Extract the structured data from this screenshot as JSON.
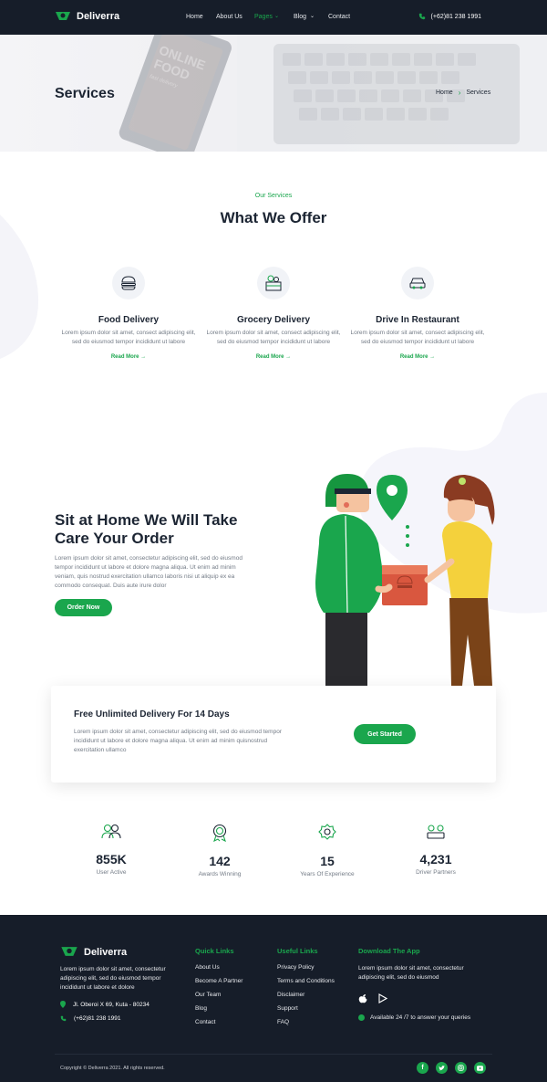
{
  "nav": {
    "brand": "Deliverra",
    "items": [
      {
        "label": "Home"
      },
      {
        "label": "About Us"
      },
      {
        "label": "Pages"
      },
      {
        "label": "Blog"
      },
      {
        "label": "Contact"
      }
    ],
    "phone": "(+62)81 238 1991"
  },
  "hero": {
    "title": "Services",
    "breadcrumb": [
      "Home",
      "Services"
    ],
    "bg_text": [
      "ONLINE",
      "FOOD",
      "fast delivery"
    ]
  },
  "offer": {
    "subtitle": "Our Services",
    "title": "What We Offer",
    "cards": [
      {
        "title": "Food Delivery",
        "text": "Lorem ipsum dolor sit amet, consect adipiscing elit, sed do eiusmod tempor incididunt ut labore",
        "link": "Read More",
        "icon": "burger-icon"
      },
      {
        "title": "Grocery Delivery",
        "text": "Lorem ipsum dolor sit amet, consect adipiscing elit, sed do eiusmod tempor incididunt ut labore",
        "link": "Read More",
        "icon": "grocery-basket-icon"
      },
      {
        "title": "Drive In Restaurant",
        "text": "Lorem ipsum dolor sit amet, consect adipiscing elit, sed do eiusmod tempor incididunt ut labore",
        "link": "Read More",
        "icon": "car-icon"
      }
    ]
  },
  "promo": {
    "title": "Sit at Home We Will Take Care Your Order",
    "text": "Lorem ipsum dolor sit amet, consectetur adipiscing elit, sed do eiusmod tempor incididunt ut labore et dolore magna aliqua. Ut enim ad minim veniam, quis nostrud exercitation ullamco laboris nisi ut aliquip ex ea commodo consequat. Duis aute irure dolor",
    "button": "Order Now"
  },
  "delivery": {
    "title": "Free Unlimited Delivery For 14 Days",
    "text": "Lorem ipsum dolor sit amet, consectetur adipiscing elit, sed do eiusmod tempor incididunt ut labore et dolore magna aliqua. Ut enim ad minim quisnostrud exercitation ullamco",
    "button": "Get Started"
  },
  "stats": [
    {
      "value": "855K",
      "label": "User Active",
      "icon": "users-icon"
    },
    {
      "value": "142",
      "label": "Awards Winning",
      "icon": "award-icon"
    },
    {
      "value": "15",
      "label": "Years Of Experience",
      "icon": "badge-icon"
    },
    {
      "value": "4,231",
      "label": "Driver Partners",
      "icon": "drivers-icon"
    }
  ],
  "footer": {
    "brand": "Deliverra",
    "about": "Lorem ipsum dolor sit amet, consectetur adipiscing elit, sed do eiusmod tempor incididunt ut labore et dolore",
    "address": "Jl. Oberoi X 69, Kuta - 80234",
    "phone": "(+62)81 238 1991",
    "quick_links": {
      "title": "Quick Links",
      "items": [
        "About Us",
        "Become A Partner",
        "Our Team",
        "Blog",
        "Contact"
      ]
    },
    "useful_links": {
      "title": "Useful Links",
      "items": [
        "Privacy Policy",
        "Terms and Conditions",
        "Disclaimer",
        "Support",
        "FAQ"
      ]
    },
    "app": {
      "title": "Download The App",
      "text": "Lorem ipsum dolor sit amet, consectetur adipiscing elit, sed do eiusmod",
      "availability": "Available 24 /7 to answer your queries"
    },
    "copyright": "Copyright © Deliverra 2021. All rights reserved."
  },
  "colors": {
    "accent": "#1aa64d",
    "dark": "#161d29"
  }
}
